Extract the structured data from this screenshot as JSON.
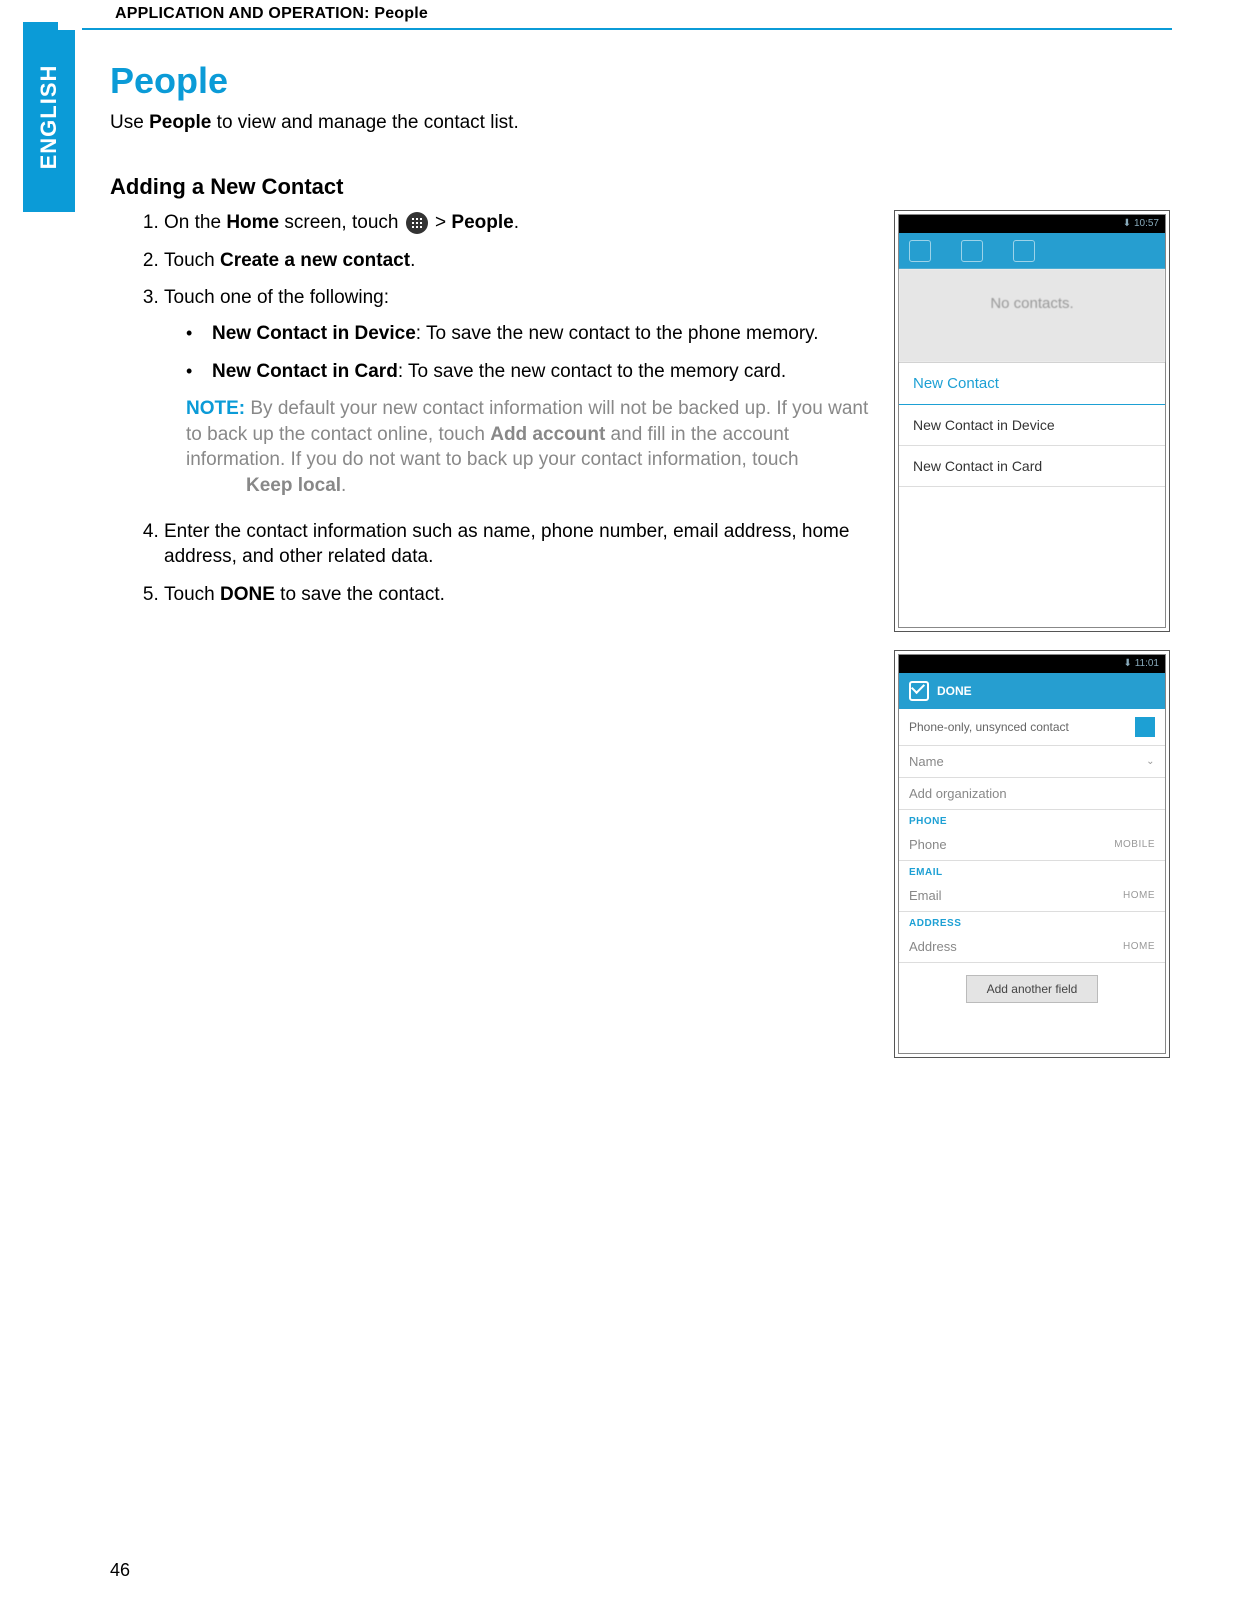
{
  "header": {
    "running_title": "APPLICATION AND OPERATION: People",
    "side_tab": "ENGLISH",
    "page_number": "46"
  },
  "title": "People",
  "intro": {
    "pre": "Use ",
    "bold": "People",
    "post": " to view and manage the contact list."
  },
  "section_heading": "Adding a New Contact",
  "steps": {
    "s1": {
      "pre": "On the ",
      "b1": "Home",
      "mid": " screen, touch ",
      "post": " > ",
      "b2": "People",
      "end": "."
    },
    "s2": {
      "pre": "Touch ",
      "b1": "Create a new contact",
      "end": "."
    },
    "s3": {
      "text": "Touch one of the following:"
    },
    "s3a": {
      "b": "New Contact in Device",
      "rest": ": To save the new contact to the phone memory."
    },
    "s3b": {
      "b": "New Contact in Card",
      "rest": ": To save the new contact to the memory card."
    },
    "note": {
      "label": "NOTE:",
      "line1": " By default your new contact information will not be backed up. If you want to back up the contact online, touch ",
      "b1": "Add account",
      "line2": " and fill in the account information. If you do not want to back up your contact information, touch ",
      "b2": "Keep local",
      "end": "."
    },
    "s4": {
      "text": "Enter the contact information such as name, phone number, email address, home address, and other related data."
    },
    "s5": {
      "pre": "Touch ",
      "b1": "DONE",
      "end": " to save the contact."
    }
  },
  "screenshot1": {
    "time": "10:57",
    "no_contacts": "No contacts.",
    "dialog_title": "New Contact",
    "option1": "New Contact in Device",
    "option2": "New Contact in Card"
  },
  "screenshot2": {
    "time": "11:01",
    "done": "DONE",
    "contact_type": "Phone-only, unsynced contact",
    "name": "Name",
    "add_org": "Add organization",
    "sec_phone": "PHONE",
    "phone": "Phone",
    "phone_type": "MOBILE",
    "sec_email": "EMAIL",
    "email": "Email",
    "email_type": "HOME",
    "sec_address": "ADDRESS",
    "address": "Address",
    "address_type": "HOME",
    "add_field": "Add another field"
  }
}
